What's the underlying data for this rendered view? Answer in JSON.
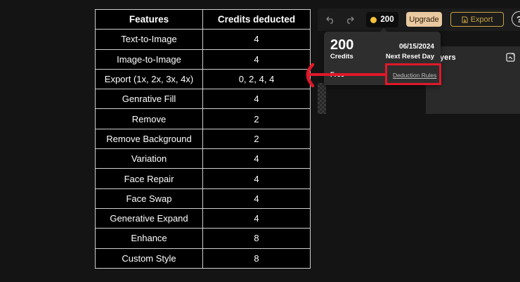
{
  "table": {
    "headers": [
      "Features",
      "Credits deducted"
    ],
    "rows": [
      [
        "Text-to-Image",
        "4"
      ],
      [
        "Image-to-Image",
        "4"
      ],
      [
        "Export (1x, 2x, 3x, 4x)",
        "0, 2, 4, 4"
      ],
      [
        "Genrative Fill",
        "4"
      ],
      [
        "Remove",
        "2"
      ],
      [
        "Remove Background",
        "2"
      ],
      [
        "Variation",
        "4"
      ],
      [
        "Face Repair",
        "4"
      ],
      [
        "Face Swap",
        "4"
      ],
      [
        "Generative Expand",
        "4"
      ],
      [
        "Enhance",
        "8"
      ],
      [
        "Custom Style",
        "8"
      ]
    ]
  },
  "toolbar": {
    "undo_icon": "undo-icon",
    "redo_icon": "redo-icon",
    "credits_count": "200",
    "upgrade_label": "Upgrade",
    "export_label": "Export",
    "help_label": "?"
  },
  "popup": {
    "credits_count": "200",
    "credits_label": "Credits",
    "reset_date": "06/15/2024",
    "reset_label": "Next Reset Day",
    "plan_label": "Free",
    "deduction_link": "Deduction Rules"
  },
  "layers": {
    "title": "yers"
  },
  "colors": {
    "highlight": "#e0182a",
    "coin": "#f3c238",
    "upgrade_bg": "#e9c9a0",
    "export_border": "#c9a441"
  }
}
